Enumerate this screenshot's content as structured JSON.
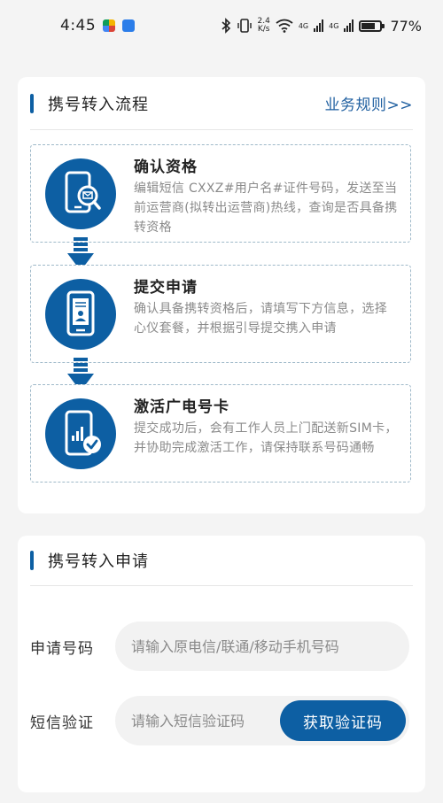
{
  "status_bar": {
    "time": "4:45",
    "net_speed_value": "2.4",
    "net_speed_unit": "K/s",
    "sim1_label": "4G",
    "sim2_label": "4G",
    "battery": "77%"
  },
  "process_card": {
    "title": "携号转入流程",
    "rules_link": "业务规则>>",
    "steps": [
      {
        "title": "确认资格",
        "description": "编辑短信 CXXZ#用户名#证件号码，发送至当前运营商(拟转出运营商)热线，查询是否具备携转资格",
        "icon": "phone-message-search-icon"
      },
      {
        "title": "提交申请",
        "description": "确认具备携转资格后，请填写下方信息，选择心仪套餐，并根据引导提交携入申请",
        "icon": "phone-id-card-icon"
      },
      {
        "title": "激活广电号卡",
        "description": "提交成功后，会有工作人员上门配送新SIM卡，并协助完成激活工作，请保持联系号码通畅",
        "icon": "phone-signal-check-icon"
      }
    ]
  },
  "apply_card": {
    "title": "携号转入申请",
    "phone_label": "申请号码",
    "phone_placeholder": "请输入原电信/联通/移动手机号码",
    "sms_label": "短信验证",
    "sms_placeholder": "请输入短信验证码",
    "sms_button": "获取验证码"
  },
  "colors": {
    "accent": "#0d5fa3",
    "background": "#f4f4f4",
    "muted_text": "#8a8a8a"
  }
}
